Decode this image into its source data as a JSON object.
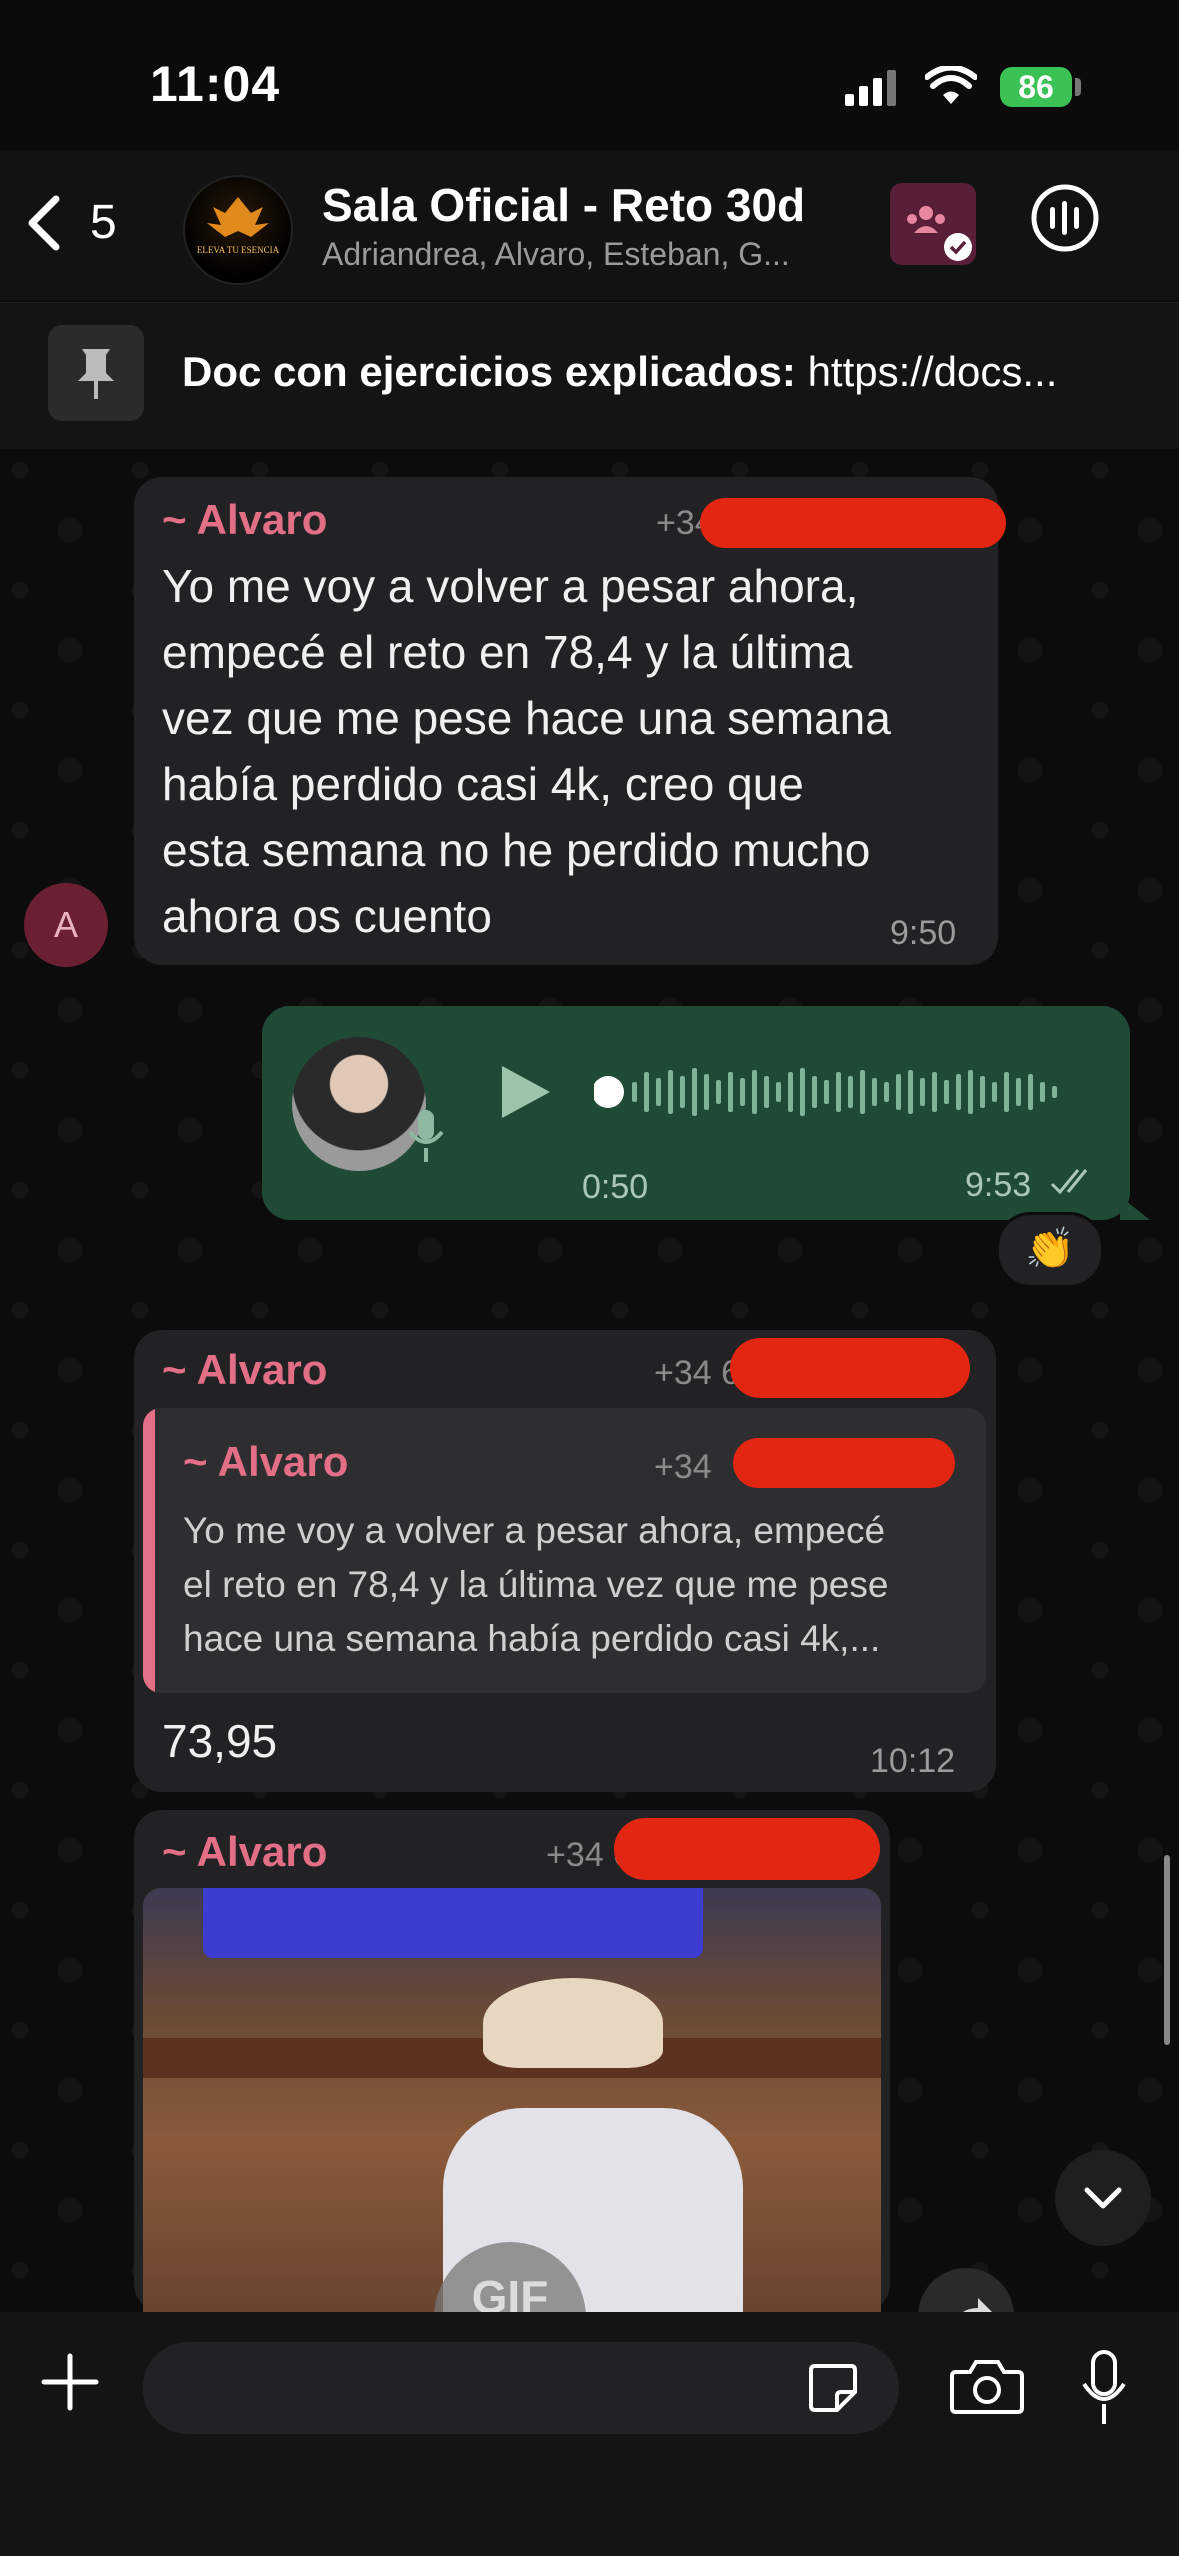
{
  "status_bar": {
    "time": "11:04",
    "battery": "86"
  },
  "header": {
    "back_count": "5",
    "title": "Sala Oficial - Reto 30d",
    "subtitle": "Adriandrea, Alvaro, Esteban, G...",
    "avatar_logo_text": "ELEVA TU ESENCIA"
  },
  "pinned": {
    "label": "Doc con ejercicios explicados:",
    "value": "https://docs..."
  },
  "messages": [
    {
      "sender": "~ Alvaro",
      "phone": "+34",
      "avatar_initial": "A",
      "lines": [
        "Yo me voy a volver a pesar ahora,",
        "empecé el reto en 78,4 y la última",
        "vez que me pese hace una semana",
        "había perdido casi 4k, creo que",
        "esta semana no he perdido mucho",
        "ahora os cuento"
      ],
      "time": "9:50"
    },
    {
      "type": "voice",
      "duration": "0:50",
      "time": "9:53",
      "reaction": "👏"
    },
    {
      "sender": "~ Alvaro",
      "phone": "+34 6",
      "quote": {
        "sender": "~ Alvaro",
        "phone": "+34",
        "lines": [
          "Yo me voy a volver a pesar ahora, empecé",
          "el reto en 78,4 y la última vez que me pese",
          "hace una semana había perdido casi 4k,..."
        ]
      },
      "text": "73,95",
      "time": "10:12"
    },
    {
      "sender": "~ Alvaro",
      "phone": "+34 6",
      "media_label": "GIF"
    }
  ],
  "colors": {
    "sender": "#e36f86",
    "outgoing": "#1f4b36",
    "incoming": "#222224",
    "redaction": "#e32612"
  }
}
